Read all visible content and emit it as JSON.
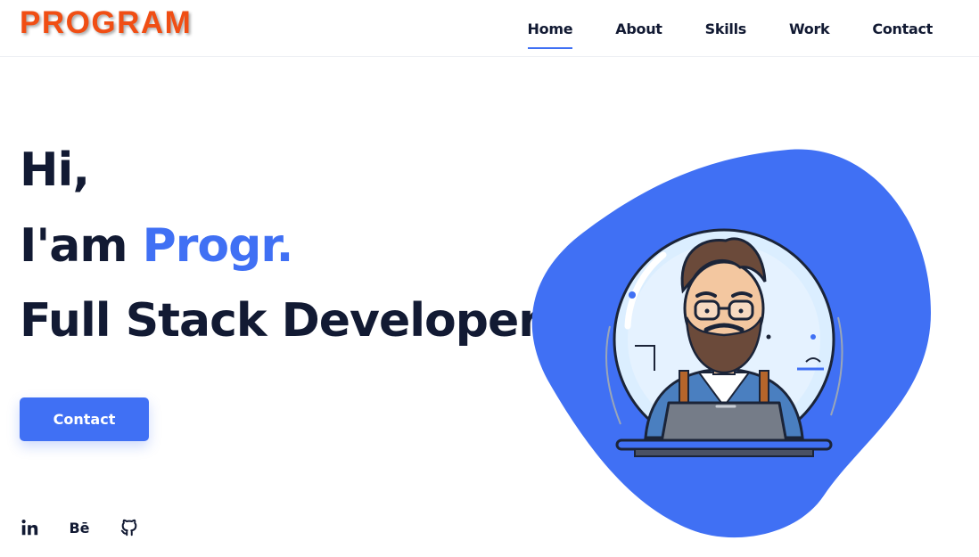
{
  "header": {
    "logo": "PROGRAM",
    "nav": [
      {
        "label": "Home",
        "active": true
      },
      {
        "label": "About",
        "active": false
      },
      {
        "label": "Skills",
        "active": false
      },
      {
        "label": "Work",
        "active": false
      },
      {
        "label": "Contact",
        "active": false
      }
    ]
  },
  "hero": {
    "greeting": "Hi,",
    "intro_prefix": "I'am ",
    "name": "Progr.",
    "role": "Full Stack Developer",
    "cta_label": "Contact"
  },
  "social": {
    "linkedin_icon": "linkedin-icon",
    "behance_label": "Bē",
    "github_icon": "github-icon"
  },
  "colors": {
    "accent": "#4070f4",
    "logo": "#f04e14",
    "text": "#121a33"
  }
}
